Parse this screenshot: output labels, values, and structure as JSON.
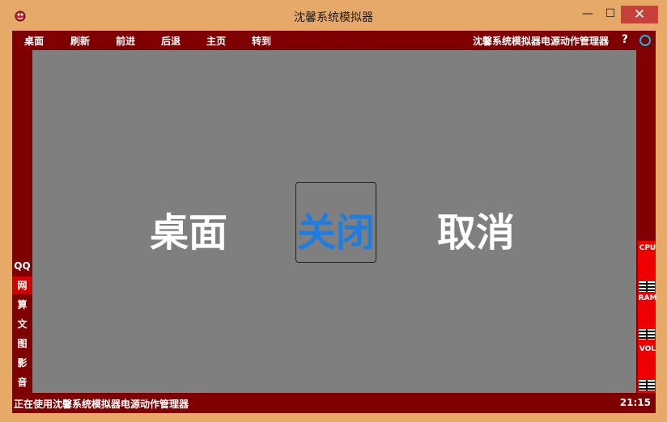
{
  "window": {
    "title": "沈馨系统模拟器",
    "min_label": "—",
    "max_label": "☐",
    "close_label": "✕"
  },
  "menu": {
    "items": [
      "桌面",
      "刷新",
      "前进",
      "后退",
      "主页",
      "转到"
    ],
    "title": "沈馨系统模拟器电源动作管理器",
    "help": "?"
  },
  "main": {
    "desktop_label": "桌面",
    "close_label": "关闭",
    "cancel_label": "取消"
  },
  "sidebar": {
    "items": [
      "QQ",
      "网",
      "算",
      "文",
      "图",
      "影",
      "音"
    ],
    "active_index": 1
  },
  "meters": {
    "labels": [
      "CPU",
      "RAM",
      "VOL"
    ]
  },
  "status": {
    "text": "正在使用沈馨系统模拟器电源动作管理器",
    "clock": "21:15"
  },
  "colors": {
    "frame": "#e7a968",
    "app_bg": "#7f0000",
    "canvas": "#7f7f7f",
    "accent_blue": "#1f7de0",
    "active_red": "#d00000",
    "meter_red": "#ef0000"
  }
}
